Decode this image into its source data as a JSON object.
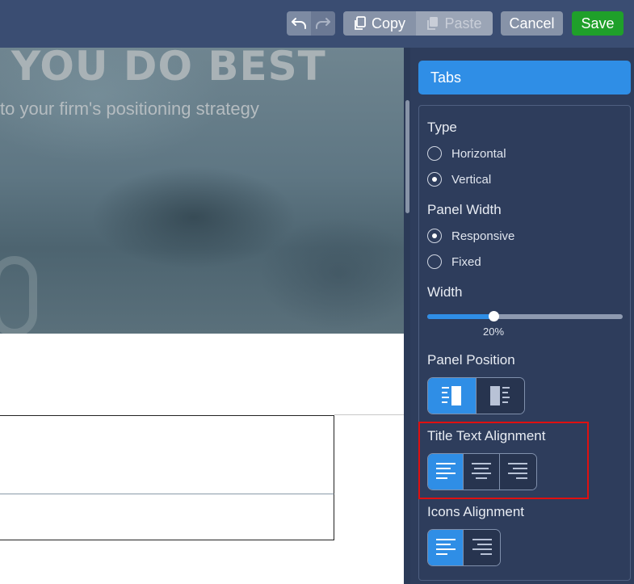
{
  "toolbar": {
    "copy_label": "Copy",
    "paste_label": "Paste",
    "cancel_label": "Cancel",
    "save_label": "Save"
  },
  "canvas": {
    "hero_title": "YOU DO BEST",
    "hero_subtitle": "to your firm's positioning strategy"
  },
  "panel": {
    "header": "Tabs",
    "type": {
      "label": "Type",
      "options": [
        "Horizontal",
        "Vertical"
      ],
      "selected": "Vertical"
    },
    "panel_width": {
      "label": "Panel Width",
      "options": [
        "Responsive",
        "Fixed"
      ],
      "selected": "Responsive"
    },
    "width": {
      "label": "Width",
      "value": 0.34,
      "value_label": "20%"
    },
    "panel_position": {
      "label": "Panel Position",
      "options": [
        "left-panel-icon",
        "right-panel-icon"
      ],
      "selected": 0
    },
    "title_text_alignment": {
      "label": "Title Text Alignment",
      "options": [
        "align-left-icon",
        "align-center-icon",
        "align-right-icon"
      ],
      "selected": 0
    },
    "icons_alignment": {
      "label": "Icons Alignment",
      "options": [
        "align-left-icon",
        "align-right-icon"
      ],
      "selected": 0
    }
  },
  "colors": {
    "accent": "#2f8ee6",
    "panel_bg": "#2e3d5c",
    "toolbar_bg": "#3a4d72",
    "save": "#1fa02a",
    "highlight": "#e01010"
  }
}
